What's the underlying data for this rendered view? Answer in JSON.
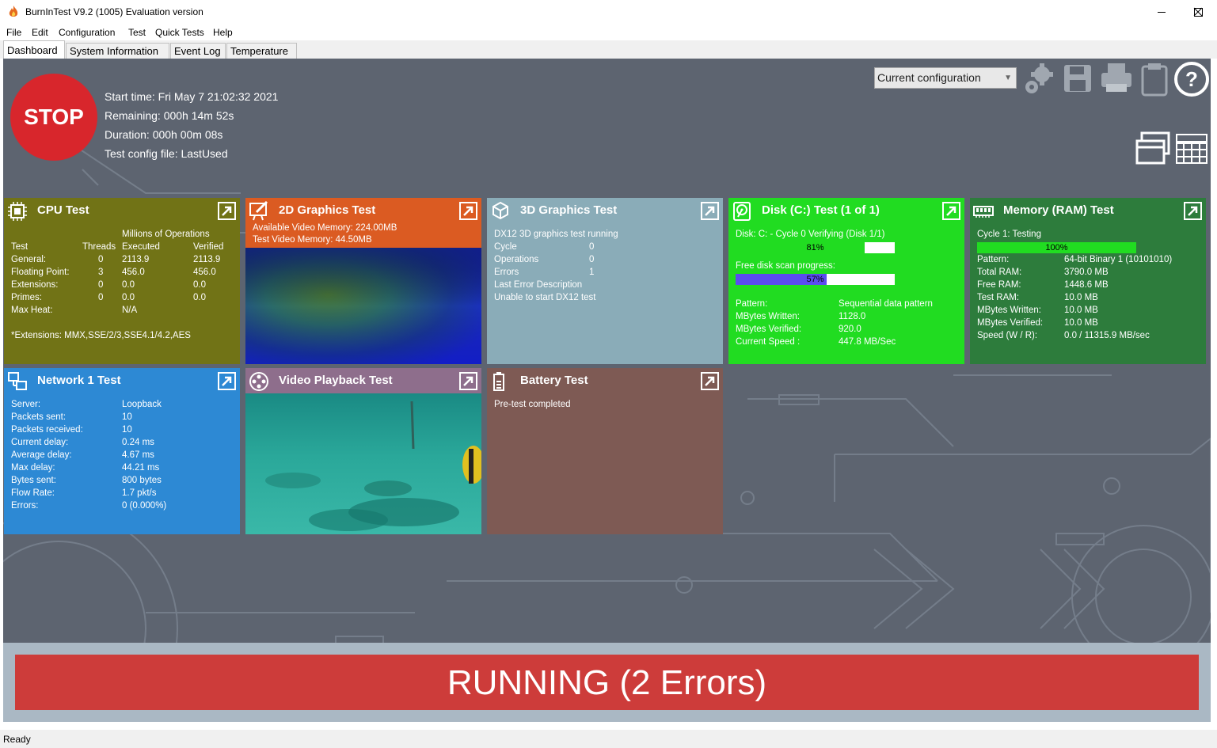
{
  "window": {
    "title": "BurnInTest V9.2 (1005) Evaluation version"
  },
  "menu": [
    "File",
    "Edit",
    "Configuration",
    "Test",
    "Quick Tests",
    "Help"
  ],
  "tabs": [
    "Dashboard",
    "System Information",
    "Event Log",
    "Temperature"
  ],
  "header": {
    "stop_label": "STOP",
    "start_time": "Start time: Fri May  7 21:02:32 2021",
    "remaining": "Remaining: 000h 14m 52s",
    "duration": "Duration: 000h 00m 08s",
    "config_file": "Test config file: LastUsed",
    "config_select": "Current configuration"
  },
  "icons": {
    "settings": "gear-icon",
    "save": "save-icon",
    "print": "printer-icon",
    "clipboard": "clipboard-icon",
    "help": "help-icon",
    "window": "window-view-icon",
    "grid": "grid-view-icon",
    "open": "open-arrow-icon"
  },
  "colors": {
    "cpu": "#717316",
    "graphics2d": "#db5b22",
    "graphics3d": "#8aacb8",
    "disk": "#21dc21",
    "memory": "#2d7c3c",
    "network": "#2d89d4",
    "video": "#8e6e8c",
    "battery": "#7e5a54",
    "running": "#cd3c3a",
    "stop": "#d8262c"
  },
  "cpu": {
    "title": "CPU Test",
    "header_mo": "Millions of Operations",
    "cols": [
      "Test",
      "Threads",
      "Executed",
      "Verified"
    ],
    "rows": [
      {
        "label": "General:",
        "threads": "0",
        "executed": "2113.9",
        "verified": "2113.9"
      },
      {
        "label": "Floating Point:",
        "threads": "3",
        "executed": "456.0",
        "verified": "456.0"
      },
      {
        "label": "Extensions:",
        "threads": "0",
        "executed": "0.0",
        "verified": "0.0"
      },
      {
        "label": "Primes:",
        "threads": "0",
        "executed": "0.0",
        "verified": "0.0"
      }
    ],
    "max_heat_label": "Max Heat:",
    "max_heat": "N/A",
    "extensions": "*Extensions: MMX,SSE/2/3,SSE4.1/4.2,AES"
  },
  "g2d": {
    "title": "2D Graphics Test",
    "avail": "Available Video Memory: 224.00MB",
    "test": "Test Video Memory: 44.50MB"
  },
  "g3d": {
    "title": "3D Graphics Test",
    "status": "DX12 3D graphics test running",
    "rows": [
      {
        "label": "Cycle",
        "value": "0"
      },
      {
        "label": "Operations",
        "value": "0"
      },
      {
        "label": "Errors",
        "value": "1"
      }
    ],
    "last_error_label": "Last Error Description",
    "last_error": "Unable to start DX12 test"
  },
  "disk": {
    "title": "Disk (C:) Test (1 of 1)",
    "cycle_label": "Disk: C: - Cycle 0 Verifying (Disk 1/1)",
    "cycle_progress": 81,
    "cycle_text": "81%",
    "scan_label": "Free disk scan progress:",
    "scan_progress": 57,
    "scan_text": "57%",
    "rows": [
      {
        "label": "Pattern:",
        "value": "Sequential data pattern"
      },
      {
        "label": "MBytes Written:",
        "value": "1128.0"
      },
      {
        "label": "MBytes Verified:",
        "value": "920.0"
      },
      {
        "label": "Current Speed :",
        "value": "447.8 MB/Sec"
      }
    ]
  },
  "memory": {
    "title": "Memory (RAM) Test",
    "cycle": "Cycle 1: Testing",
    "progress": 100,
    "progress_text": "100%",
    "rows": [
      {
        "label": "Pattern:",
        "value": "64-bit Binary 1 (10101010)"
      },
      {
        "label": "Total RAM:",
        "value": "3790.0 MB"
      },
      {
        "label": "Free RAM:",
        "value": "1448.6 MB"
      },
      {
        "label": "Test RAM:",
        "value": "10.0 MB"
      },
      {
        "label": "MBytes Written:",
        "value": "10.0 MB"
      },
      {
        "label": "MBytes Verified:",
        "value": "10.0 MB"
      },
      {
        "label": "Speed (W / R):",
        "value": "0.0 / 11315.9  MB/sec"
      }
    ]
  },
  "network": {
    "title": "Network 1 Test",
    "rows": [
      {
        "label": "Server:",
        "value": "Loopback"
      },
      {
        "label": "Packets sent:",
        "value": "10"
      },
      {
        "label": "Packets received:",
        "value": "10"
      },
      {
        "label": "Current delay:",
        "value": "0.24 ms"
      },
      {
        "label": "Average delay:",
        "value": "4.67 ms"
      },
      {
        "label": "Max delay:",
        "value": "44.21 ms"
      },
      {
        "label": "Bytes sent:",
        "value": "800 bytes"
      },
      {
        "label": "Flow Rate:",
        "value": "1.7 pkt/s"
      },
      {
        "label": "Errors:",
        "value": "0 (0.000%)"
      }
    ]
  },
  "video": {
    "title": "Video Playback Test"
  },
  "battery": {
    "title": "Battery Test",
    "status": "Pre-test completed"
  },
  "status_banner": "RUNNING (2 Errors)",
  "statusbar": "Ready"
}
